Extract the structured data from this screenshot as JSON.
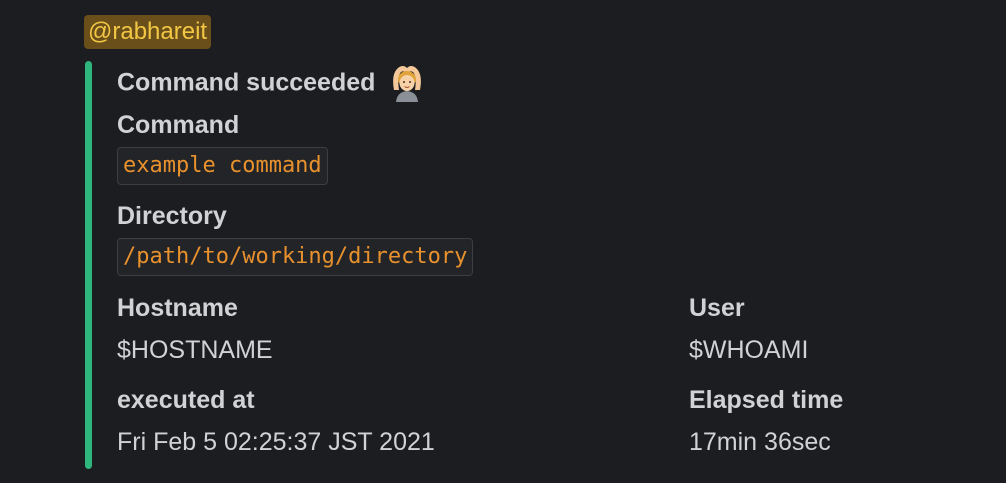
{
  "mention": "@rabhareit",
  "attachment": {
    "bar_color": "#2eb67d",
    "title": "Command succeeded",
    "title_emoji": "person-gesturing-ok-icon",
    "command": {
      "label": "Command",
      "value": "example command"
    },
    "directory": {
      "label": "Directory",
      "value": "/path/to/working/directory"
    },
    "hostname": {
      "label": "Hostname",
      "value": "$HOSTNAME"
    },
    "user": {
      "label": "User",
      "value": "$WHOAMI"
    },
    "executed_at": {
      "label": "executed at",
      "value": "Fri Feb 5 02:25:37 JST 2021"
    },
    "elapsed": {
      "label": "Elapsed time",
      "value": "17min 36sec"
    }
  }
}
